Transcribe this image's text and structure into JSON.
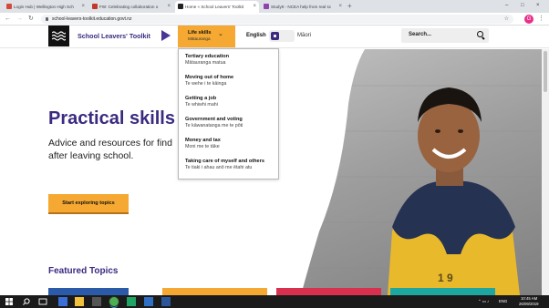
{
  "browser": {
    "tabs": [
      {
        "label": "Login Hub | Wellington High Sch",
        "active": false,
        "favicon_color": "#d44a3a"
      },
      {
        "label": "FW: Celebrating collaboration o",
        "active": false,
        "favicon_color": "#c0392b"
      },
      {
        "label": "Home « School Leavers' Toolkit",
        "active": true,
        "favicon_color": "#222222"
      },
      {
        "label": "StudyIt - NCEA help from real sc",
        "active": false,
        "favicon_color": "#8e44ad"
      }
    ],
    "new_tab": "+",
    "url": "school-leavers-toolkit.education.govt.nz",
    "avatar_letter": "G",
    "window_controls": [
      "–",
      "□",
      "×"
    ]
  },
  "header": {
    "site_title": "School Leavers' Toolkit",
    "nav_primary": "Life skills",
    "nav_secondary": "Mātauranga",
    "lang_english": "English",
    "lang_maori": "Māori",
    "search_placeholder": "Search..."
  },
  "dropdown": [
    {
      "en": "Tertiary education",
      "mi": "Mātauranga matua"
    },
    {
      "en": "Moving out of home",
      "mi": "Te wehe i te kāinga"
    },
    {
      "en": "Getting a job",
      "mi": "Te whiwhi mahi"
    },
    {
      "en": "Government and voting",
      "mi": "Te kāwanatanga me te pōti"
    },
    {
      "en": "Money and tax",
      "mi": "Moni me te tāke"
    },
    {
      "en": "Taking care of myself and others",
      "mi": "Te tiaki i ahau anō me ētahi atu"
    }
  ],
  "hero": {
    "headline": "Practical skills",
    "subhead": "Advice and resources for find after leaving school.",
    "cta_label": "Start exploring topics"
  },
  "featured": {
    "title": "Featured Topics",
    "card_colors": [
      "#2b5aa8",
      "#f5a832",
      "#d9304f",
      "#1ea6a0"
    ]
  },
  "taskbar": {
    "language": "ENG",
    "time": "10:45 AM",
    "date": "26/09/2019"
  },
  "colors": {
    "brand_purple": "#3b2a80",
    "accent_orange": "#f5a832"
  }
}
